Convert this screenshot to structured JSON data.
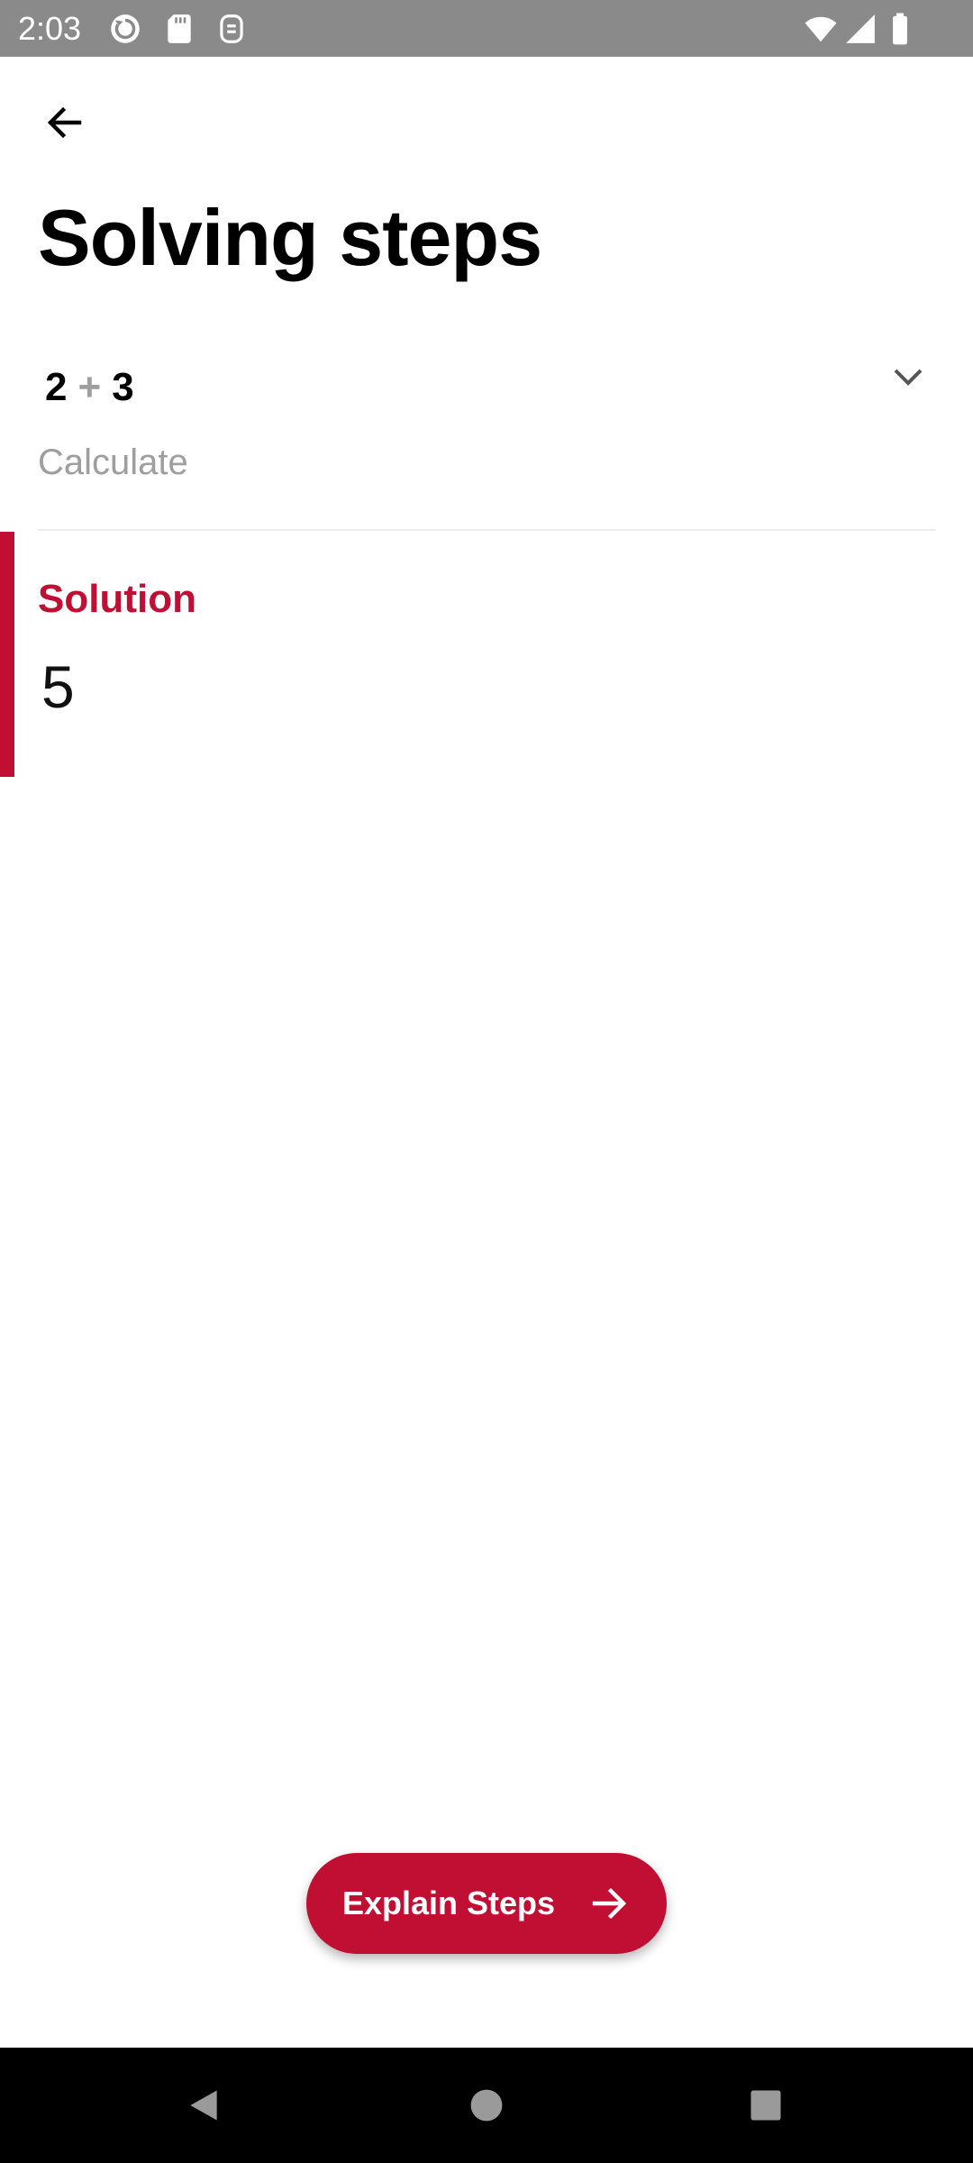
{
  "status_bar": {
    "time": "2:03",
    "icons": [
      "sync-icon",
      "sd-card-icon",
      "assistant-icon",
      "wifi-icon",
      "cell-signal-icon",
      "battery-icon"
    ]
  },
  "header": {
    "back_icon": "arrow-left-icon",
    "title": "Solving steps"
  },
  "problem": {
    "operand_a": "2",
    "operator": "+",
    "operand_b": "3",
    "label": "Calculate",
    "expand_icon": "chevron-down-icon"
  },
  "solution": {
    "heading": "Solution",
    "value": "5"
  },
  "explain_button": {
    "label": "Explain Steps",
    "icon": "arrow-right-icon"
  },
  "nav_bar": {
    "buttons": [
      "back-triangle-icon",
      "home-circle-icon",
      "recents-square-icon"
    ]
  },
  "colors": {
    "accent": "#c00f33",
    "status_bar": "#8a8a8a",
    "muted_text": "#9e9e9e",
    "nav_bar": "#000000"
  }
}
